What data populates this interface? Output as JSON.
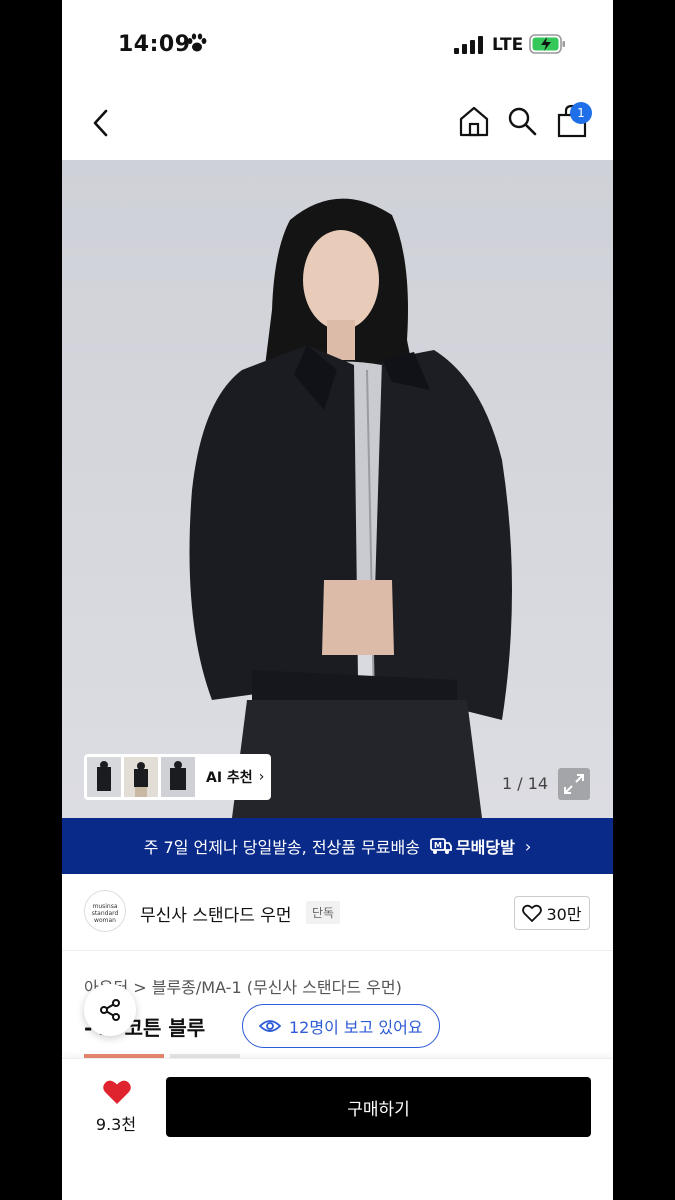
{
  "status_bar": {
    "time": "14:09",
    "network": "LTE"
  },
  "nav": {
    "cart_count": "1"
  },
  "hero": {
    "image_counter": "1 / 14",
    "ai_recommend_label": "AI 추천"
  },
  "banner": {
    "text": "주 7일 언제나 당일발송, 전상품 무료배송",
    "service_name": "무배당발"
  },
  "brand": {
    "logo_text": "musinsa standard woman",
    "name": "무신사 스탠다드 우먼",
    "tag": "단독",
    "likes": "30만"
  },
  "product": {
    "breadcrumb": "아우터 > 블루종/MA-1 (무신사 스탠다드 우먼)",
    "title_partial": "-  스 코튼 블루",
    "viewers_text": "12명이 보고 있어요"
  },
  "bottom_bar": {
    "wishlist_count": "9.3천",
    "buy_label": "구매하기"
  },
  "colors": {
    "banner_bg": "#0a2a8a",
    "accent_blue": "#2e5bd6",
    "heart_red": "#e0242f",
    "buy_bg": "#000000"
  }
}
